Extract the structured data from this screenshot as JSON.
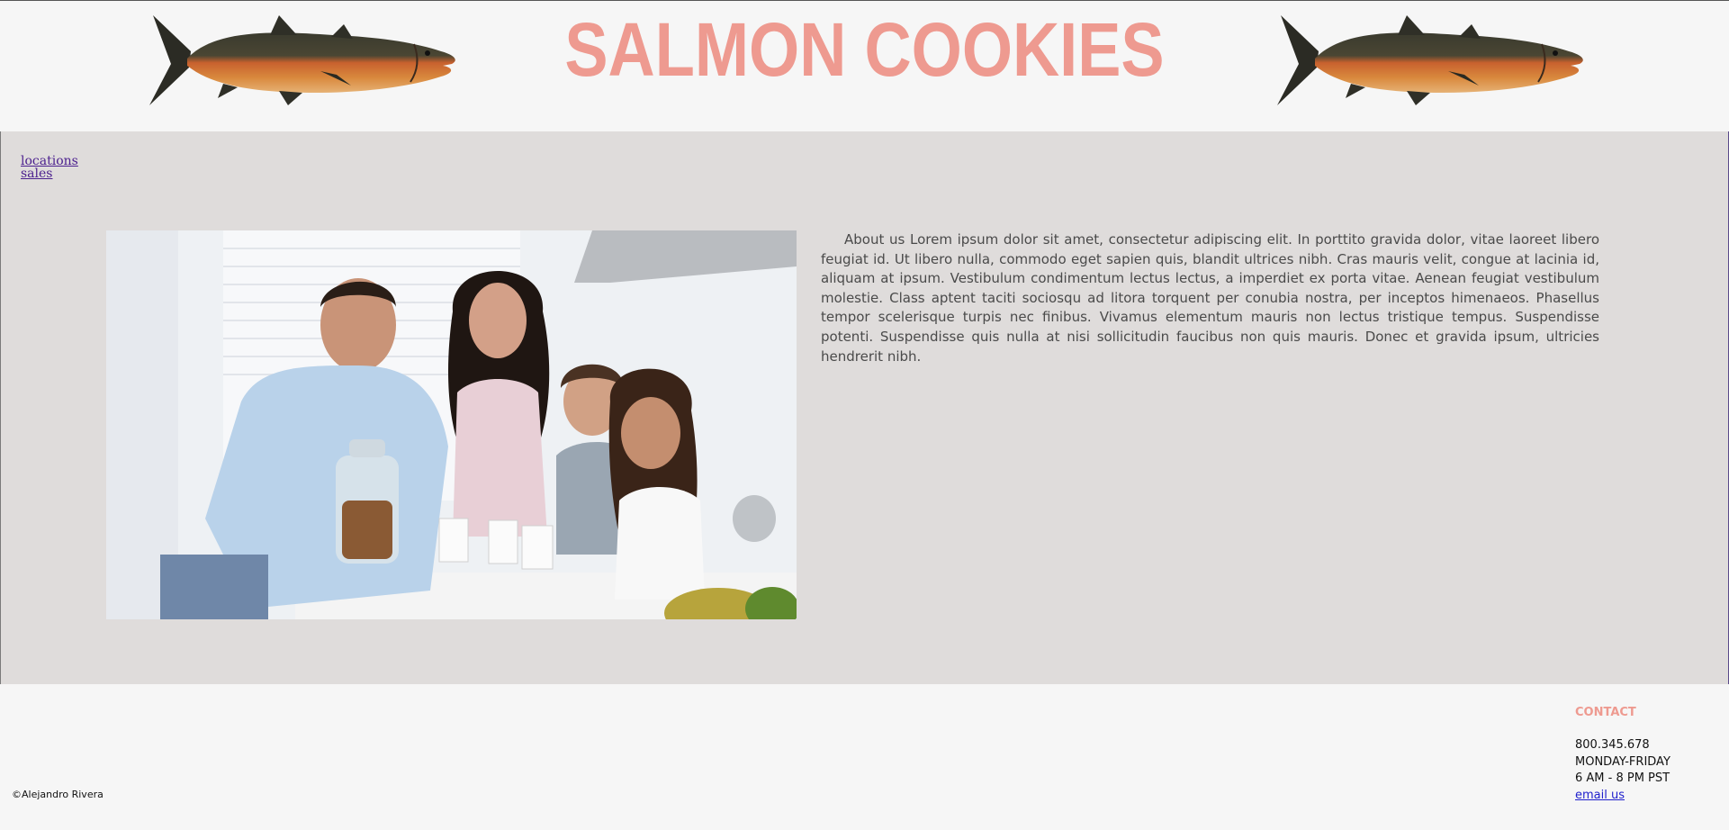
{
  "header": {
    "title": "SALMON COOKIES",
    "fish_left_icon": "salmon-fish-image",
    "fish_right_icon": "salmon-fish-image"
  },
  "nav": {
    "links": [
      "locations",
      "sales"
    ]
  },
  "main": {
    "photo_icon": "family-with-cookie-jar-photo",
    "about_text": "About us Lorem ipsum dolor sit amet, consectetur adipiscing elit. In porttito gravida dolor, vitae laoreet libero feugiat id. Ut libero nulla, commodo eget sapien quis, blandit ultrices nibh. Cras mauris velit, congue at lacinia id, aliquam at ipsum. Vestibulum condimentum lectus lectus, a imperdiet ex porta vitae. Aenean feugiat vestibulum molestie. Class aptent taciti sociosqu ad litora torquent per conubia nostra, per inceptos himenaeos. Phasellus tempor scelerisque turpis nec finibus. Vivamus elementum mauris non lectus tristique tempus. Suspendisse potenti. Suspendisse quis nulla at nisi sollicitudin faucibus non quis mauris. Donec et gravida ipsum, ultricies hendrerit nibh."
  },
  "footer": {
    "copyright": "©Alejandro Rivera",
    "contact": {
      "heading": "CONTACT",
      "phone": "800.345.678",
      "days": "MONDAY-FRIDAY",
      "hours": "6 AM - 8 PM PST",
      "email_label": "email us"
    }
  },
  "colors": {
    "title": "#ee9a90",
    "main_bg": "#dfdcdb",
    "page_bg": "#f6f6f6",
    "nav_link": "#4b1f8e",
    "email_link": "#1f1fcc"
  }
}
